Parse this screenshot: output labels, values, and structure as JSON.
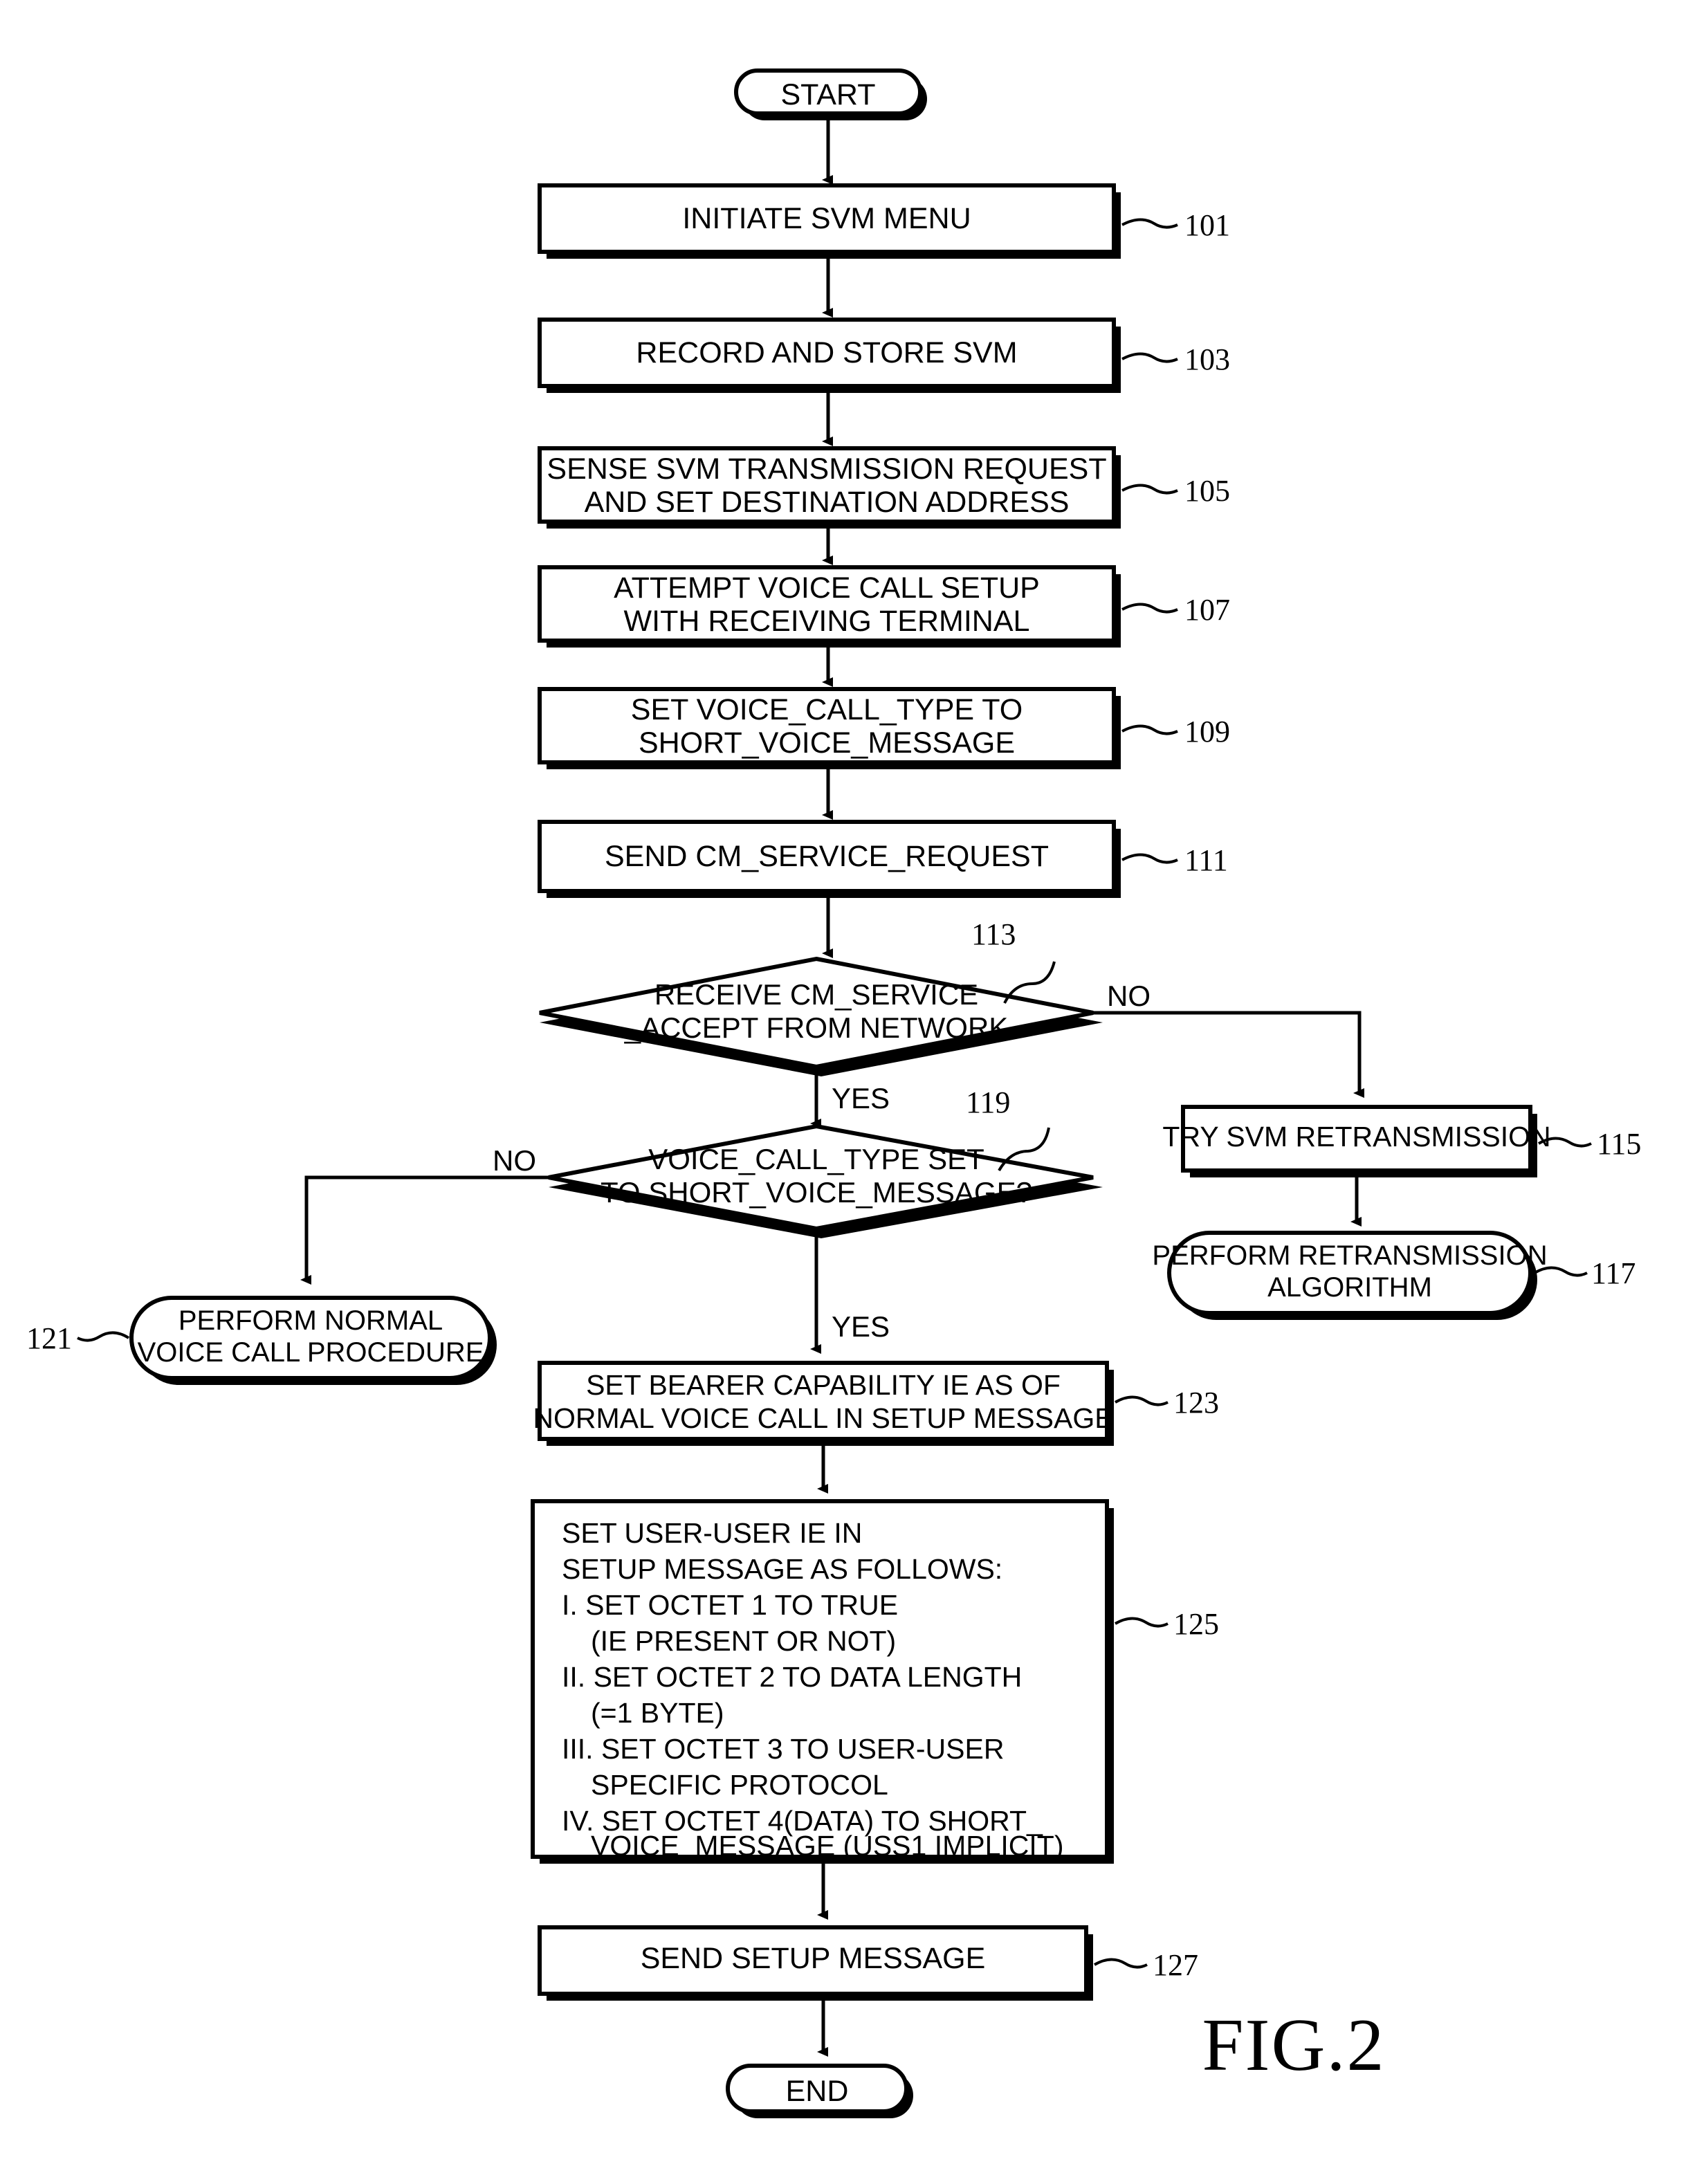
{
  "figure": {
    "label": "FIG.2",
    "type": "flowchart"
  },
  "chart_data": {
    "type": "diagram",
    "title": "FIG.2",
    "nodes": [
      {
        "id": "start",
        "ref": "",
        "shape": "terminator",
        "lines": [
          "START"
        ]
      },
      {
        "id": "n101",
        "ref": "101",
        "shape": "process",
        "lines": [
          "INITIATE SVM MENU"
        ]
      },
      {
        "id": "n103",
        "ref": "103",
        "shape": "process",
        "lines": [
          "RECORD AND STORE SVM"
        ]
      },
      {
        "id": "n105",
        "ref": "105",
        "shape": "process",
        "lines": [
          "SENSE SVM TRANSMISSION REQUEST",
          "AND SET DESTINATION ADDRESS"
        ]
      },
      {
        "id": "n107",
        "ref": "107",
        "shape": "process",
        "lines": [
          "ATTEMPT VOICE CALL SETUP",
          "WITH RECEIVING TERMINAL"
        ]
      },
      {
        "id": "n109",
        "ref": "109",
        "shape": "process",
        "lines": [
          "SET VOICE_CALL_TYPE TO",
          "SHORT_VOICE_MESSAGE"
        ]
      },
      {
        "id": "n111",
        "ref": "111",
        "shape": "process",
        "lines": [
          "SEND CM_SERVICE_REQUEST"
        ]
      },
      {
        "id": "n113",
        "ref": "113",
        "shape": "decision",
        "lines": [
          "RECEIVE CM_SERVICE",
          "_ACCEPT FROM NETWORK"
        ]
      },
      {
        "id": "n115",
        "ref": "115",
        "shape": "process",
        "lines": [
          "TRY SVM RETRANSMISSION"
        ]
      },
      {
        "id": "n117",
        "ref": "117",
        "shape": "terminator",
        "lines": [
          "PERFORM RETRANSMISSION",
          "ALGORITHM"
        ]
      },
      {
        "id": "n119",
        "ref": "119",
        "shape": "decision",
        "lines": [
          "VOICE_CALL_TYPE SET",
          "TO SHORT_VOICE_MESSAGE?"
        ]
      },
      {
        "id": "n121",
        "ref": "121",
        "shape": "terminator",
        "lines": [
          "PERFORM NORMAL",
          "VOICE CALL PROCEDURE"
        ]
      },
      {
        "id": "n123",
        "ref": "123",
        "shape": "process",
        "lines": [
          "SET BEARER CAPABILITY IE AS OF",
          "NORMAL VOICE CALL IN SETUP MESSAGE"
        ]
      },
      {
        "id": "n125",
        "ref": "125",
        "shape": "process-left",
        "lines": [
          "SET USER-USER IE IN",
          "SETUP MESSAGE AS FOLLOWS:",
          "I. SET OCTET 1 TO TRUE",
          "   (IE PRESENT OR NOT)",
          "II. SET OCTET 2 TO DATA LENGTH",
          "   (=1 BYTE)",
          "III. SET OCTET 3 TO USER-USER",
          "   SPECIFIC PROTOCOL",
          "IV. SET OCTET 4(DATA) TO  SHORT_",
          "   VOICE_MESSAGE (USS1 IMPLICIT)"
        ]
      },
      {
        "id": "n127",
        "ref": "127",
        "shape": "process",
        "lines": [
          "SEND SETUP MESSAGE"
        ]
      },
      {
        "id": "end",
        "ref": "",
        "shape": "terminator",
        "lines": [
          "END"
        ]
      }
    ],
    "edges": [
      {
        "from": "start",
        "to": "n101",
        "label": ""
      },
      {
        "from": "n101",
        "to": "n103",
        "label": ""
      },
      {
        "from": "n103",
        "to": "n105",
        "label": ""
      },
      {
        "from": "n105",
        "to": "n107",
        "label": ""
      },
      {
        "from": "n107",
        "to": "n109",
        "label": ""
      },
      {
        "from": "n109",
        "to": "n111",
        "label": ""
      },
      {
        "from": "n111",
        "to": "n113",
        "label": ""
      },
      {
        "from": "n113",
        "to": "n115",
        "label": "NO"
      },
      {
        "from": "n113",
        "to": "n119",
        "label": "YES"
      },
      {
        "from": "n115",
        "to": "n117",
        "label": ""
      },
      {
        "from": "n119",
        "to": "n121",
        "label": "NO"
      },
      {
        "from": "n119",
        "to": "n123",
        "label": "YES"
      },
      {
        "from": "n123",
        "to": "n125",
        "label": ""
      },
      {
        "from": "n125",
        "to": "n127",
        "label": ""
      },
      {
        "from": "n127",
        "to": "end",
        "label": ""
      }
    ],
    "branch_labels": [
      "NO",
      "YES",
      "NO",
      "YES"
    ],
    "reference_numerals": [
      "101",
      "103",
      "105",
      "107",
      "109",
      "111",
      "113",
      "115",
      "117",
      "119",
      "121",
      "123",
      "125",
      "127"
    ]
  },
  "text": {
    "start": "START",
    "end": "END",
    "n101_l1": "INITIATE SVM MENU",
    "n103_l1": "RECORD AND STORE SVM",
    "n105_l1": "SENSE SVM TRANSMISSION REQUEST",
    "n105_l2": "AND SET DESTINATION ADDRESS",
    "n107_l1": "ATTEMPT VOICE CALL SETUP",
    "n107_l2": "WITH RECEIVING TERMINAL",
    "n109_l1": "SET VOICE_CALL_TYPE TO",
    "n109_l2": "SHORT_VOICE_MESSAGE",
    "n111_l1": "SEND CM_SERVICE_REQUEST",
    "n113_l1": "RECEIVE CM_SERVICE",
    "n113_l2": "_ACCEPT FROM NETWORK",
    "n115_l1": "TRY SVM RETRANSMISSION",
    "n117_l1": "PERFORM RETRANSMISSION",
    "n117_l2": "ALGORITHM",
    "n119_l1": "VOICE_CALL_TYPE SET",
    "n119_l2": "TO SHORT_VOICE_MESSAGE?",
    "n121_l1": "PERFORM NORMAL",
    "n121_l2": "VOICE CALL PROCEDURE",
    "n123_l1": "SET BEARER CAPABILITY IE AS OF",
    "n123_l2": "NORMAL VOICE CALL IN SETUP MESSAGE",
    "n125_l1": "SET USER-USER IE IN",
    "n125_l2": "SETUP MESSAGE AS FOLLOWS:",
    "n125_l3": "I. SET OCTET 1 TO TRUE",
    "n125_l4": "(IE PRESENT OR NOT)",
    "n125_l5": "II. SET OCTET 2 TO DATA LENGTH",
    "n125_l6": "(=1 BYTE)",
    "n125_l7": "III. SET OCTET 3 TO USER-USER",
    "n125_l8": "SPECIFIC PROTOCOL",
    "n125_l9": "IV. SET OCTET 4(DATA) TO  SHORT_",
    "n125_l10": "VOICE_MESSAGE (USS1 IMPLICIT)",
    "n127_l1": "SEND SETUP MESSAGE",
    "ref101": "101",
    "ref103": "103",
    "ref105": "105",
    "ref107": "107",
    "ref109": "109",
    "ref111": "111",
    "ref113": "113",
    "ref115": "115",
    "ref117": "117",
    "ref119": "119",
    "ref121": "121",
    "ref123": "123",
    "ref125": "125",
    "ref127": "127",
    "no1": "NO",
    "yes1": "YES",
    "no2": "NO",
    "yes2": "YES",
    "fig": "FIG.2"
  },
  "colors": {
    "ink": "#000000",
    "paper": "#ffffff"
  }
}
